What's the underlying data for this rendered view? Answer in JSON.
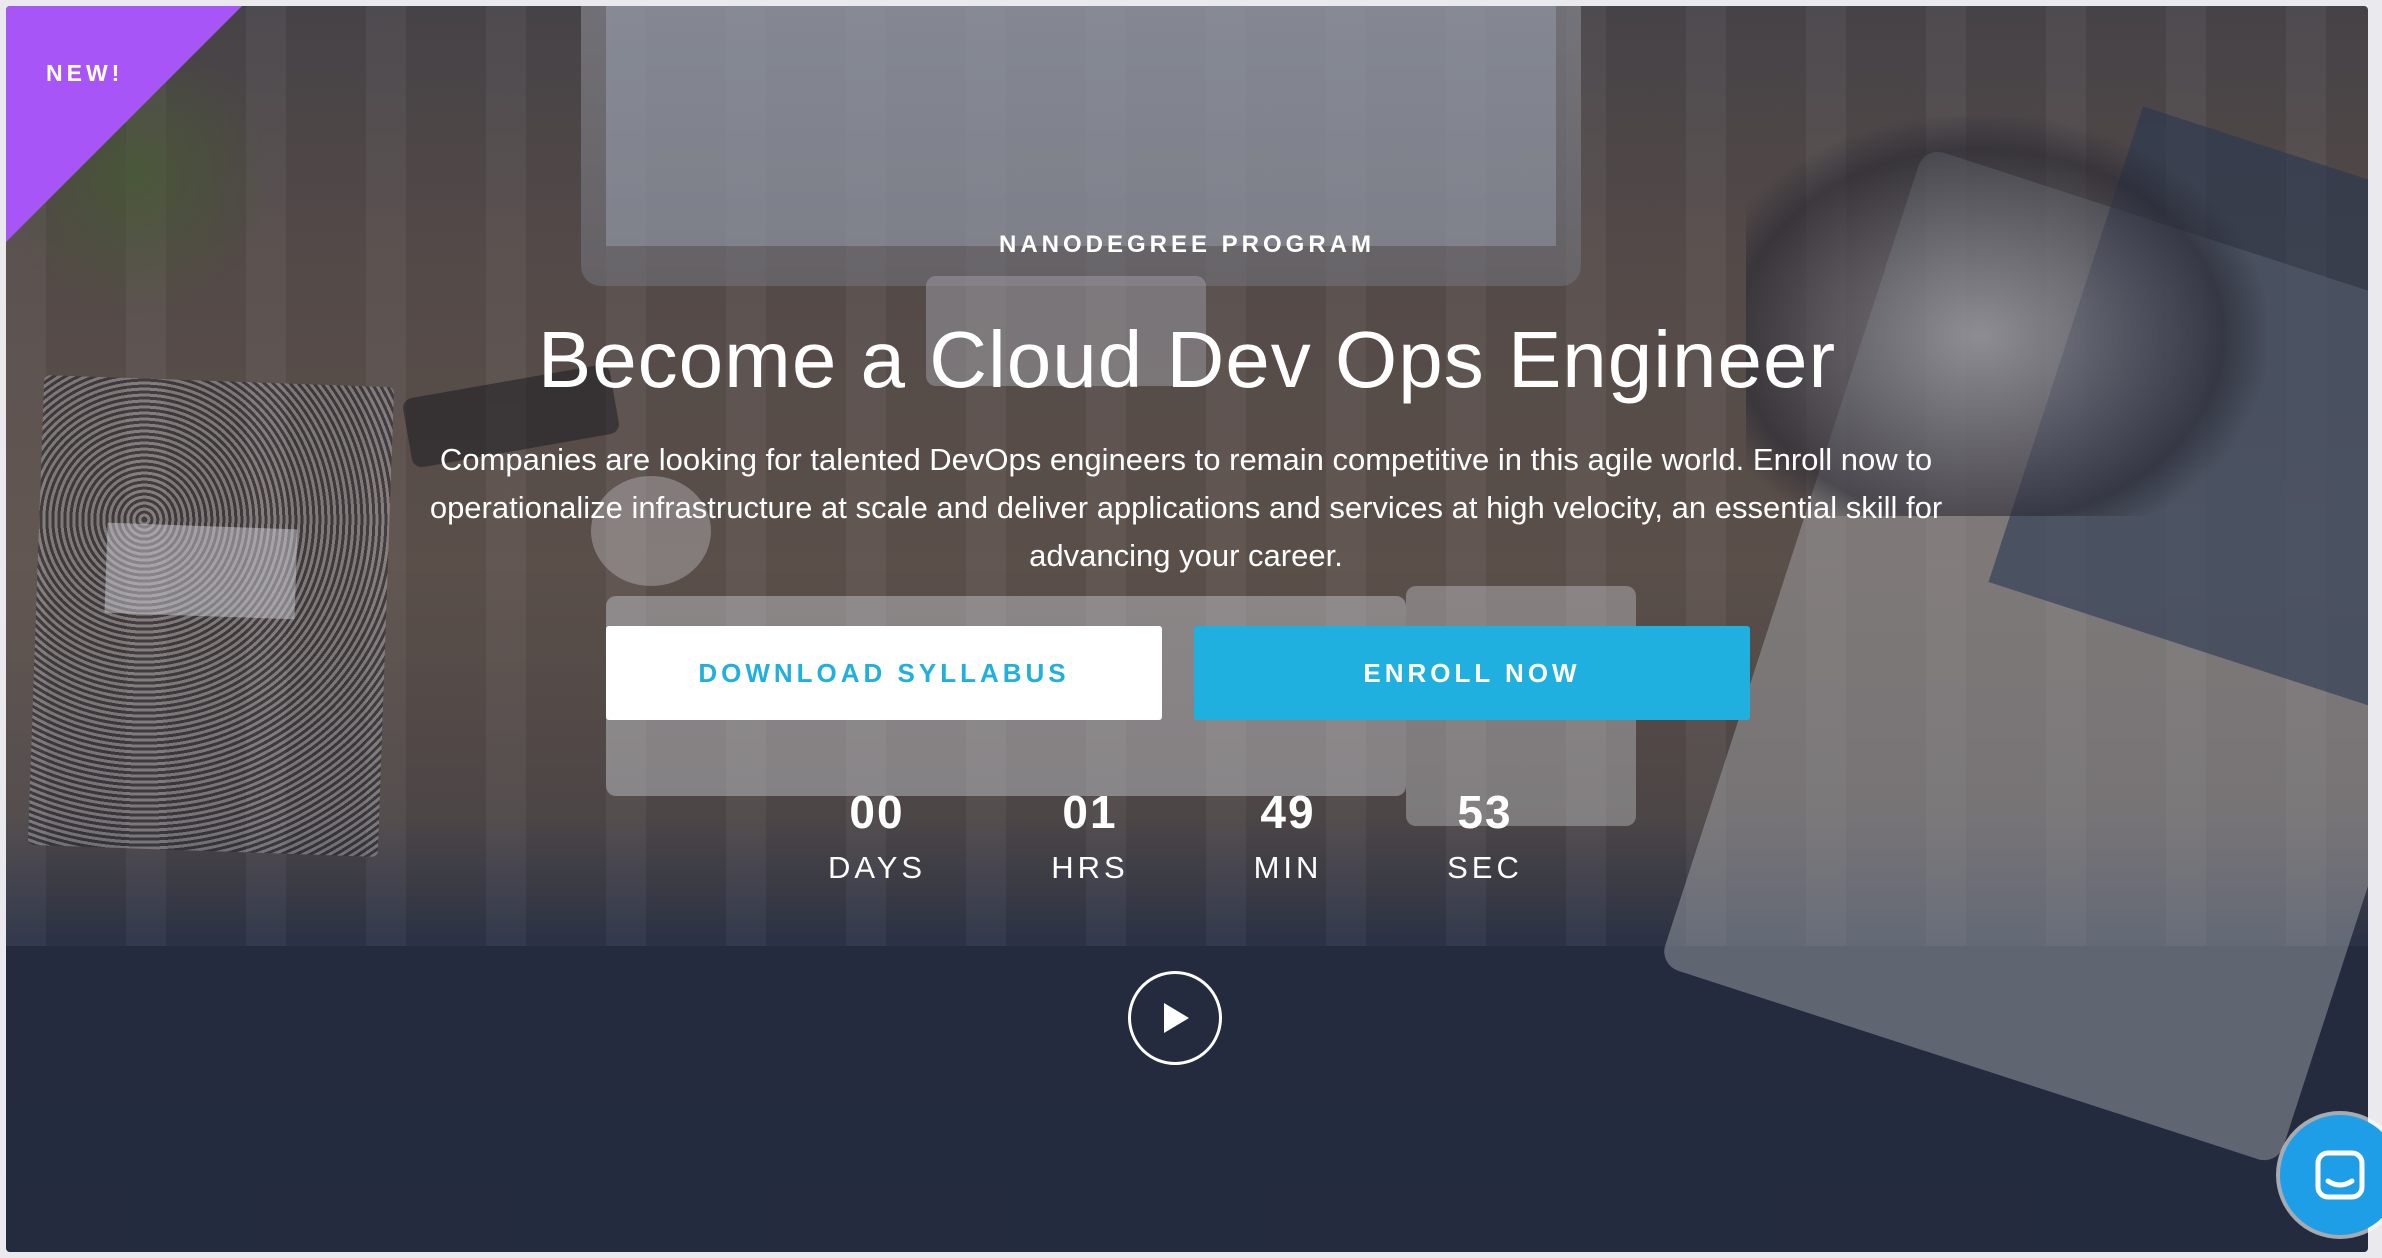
{
  "badge": {
    "label": "NEW!"
  },
  "hero": {
    "kicker": "NANODEGREE PROGRAM",
    "title": "Become a Cloud Dev Ops Engineer",
    "description": "Companies are looking for talented DevOps engineers to remain competitive in this agile world. Enroll now to operationalize infrastructure at scale and deliver applications and services at high velocity, an essential skill for advancing your career.",
    "download_label": "DOWNLOAD SYLLABUS",
    "enroll_label": "ENROLL NOW"
  },
  "countdown": {
    "days": {
      "value": "00",
      "label": "DAYS"
    },
    "hours": {
      "value": "01",
      "label": "HRS"
    },
    "minutes": {
      "value": "49",
      "label": "MIN"
    },
    "seconds": {
      "value": "53",
      "label": "SEC"
    }
  },
  "icons": {
    "play": "play-icon",
    "chat": "chat-icon"
  },
  "colors": {
    "accent": "#1fb0e0",
    "badge": "#a855f7",
    "chat": "#1f9ee8"
  }
}
